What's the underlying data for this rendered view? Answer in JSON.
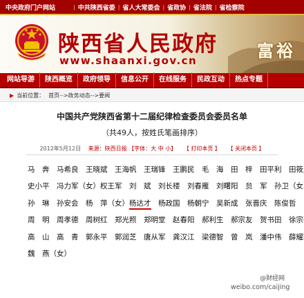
{
  "topbar": {
    "links": [
      "中央政府门户网站",
      "中共陕西省委",
      "省人大常委会",
      "省政协",
      "省法院",
      "省检察院"
    ]
  },
  "header": {
    "site_title": "陕西省人民政府",
    "site_url": "www.shaanxi.gov.cn",
    "slogan": "富裕"
  },
  "nav": {
    "items": [
      "网站导游",
      "陕西概览",
      "政府领导",
      "信息公开",
      "在线服务",
      "民政互动",
      "热点专题"
    ]
  },
  "breadcrumb": {
    "label": "当前位置：",
    "path": "首页-->政务动态-->要闻"
  },
  "article": {
    "title": "中国共产党陕西省第十二届纪律检查委员会委员名单",
    "subtitle": "（共49人，按姓氏笔画排序）",
    "meta": {
      "date": "2012年5月12日",
      "source": "来源：陕西日报",
      "font_label": "【字体：",
      "font_big": "大",
      "font_mid": "中",
      "font_small": "小",
      "font_close": "】",
      "print": "【 打印本页 】",
      "close": "【 关闭本页 】"
    },
    "names": {
      "line1": "马　奔　马希良　王晓斌　王海帆　王瑞锋　王鹏民　毛　海　田　梓　田平利　田筱虎",
      "line2": "史小平　冯力军（女）权王军　刘　斌　刘长楼　刘春雁　刘曙阳　贠　军　孙卫（女）",
      "line3_a": "孙　琳　孙安会　杨　萍（女）",
      "line3_highlight": "杨达才",
      "line3_b": "杨政国　杨朝宁　吴新成　张晋庆　陈俊哲",
      "line4": "周　明　周孝德　周树红　郑光照　郑明堂　赵春阳　郝利生　郝宗友　贺书田　徐宗一",
      "line5": "高　山　高　青　郭永平　郭润芝　唐从军　龚汉江　梁德智　曾　岚　潘中伟　薛耀瑄",
      "line6": "魏　燕（女）"
    }
  },
  "watermark": {
    "logo_text": "@财经网",
    "url": "weibo.com/caijing"
  },
  "colors": {
    "brand_red": "#b30000",
    "highlight_underline": "#d40000",
    "gold": "#e3b94d"
  }
}
